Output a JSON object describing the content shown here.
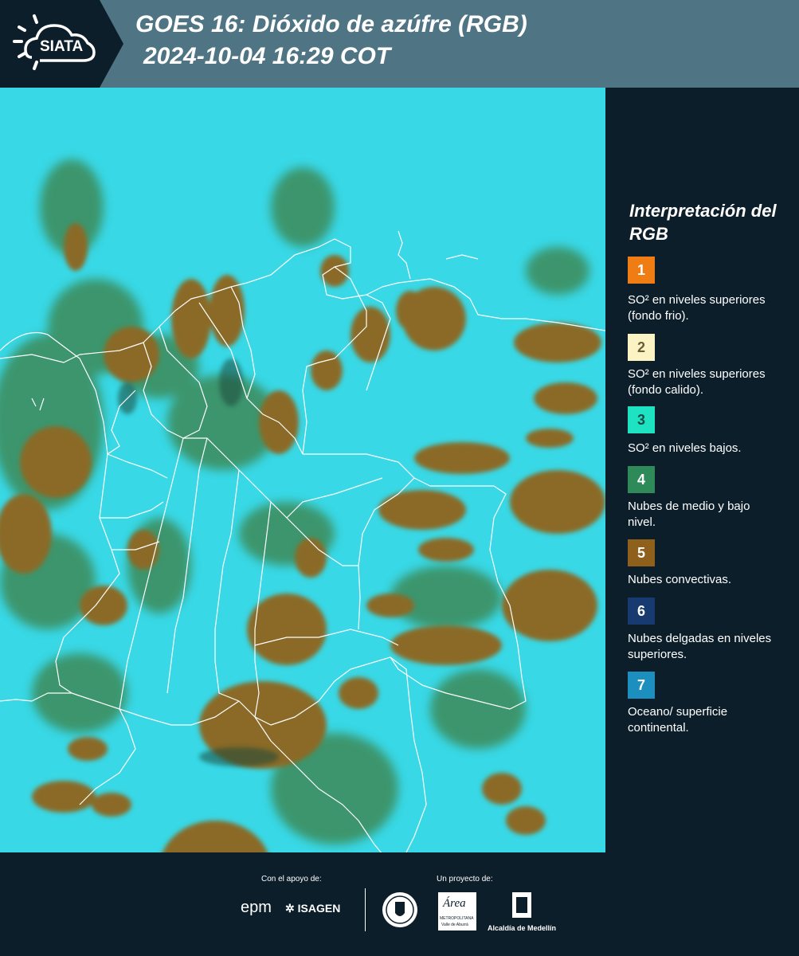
{
  "header": {
    "brand": "SIATA",
    "title_line1": "GOES 16: Dióxido de azúfre (RGB)",
    "title_line2": "2024-10-04 16:29 COT",
    "background_color": "#4f7584"
  },
  "legend": {
    "title": "Interpretación del RGB",
    "items": [
      {
        "number": "1",
        "label": "SO² en niveles superiores (fondo frio).",
        "color": "#f07d14",
        "number_color": "#ffffff"
      },
      {
        "number": "2",
        "label": "SO² en niveles superiores (fondo calido).",
        "color": "#fbf3c3",
        "number_color": "#6b5b3a"
      },
      {
        "number": "3",
        "label": "SO² en niveles bajos.",
        "color": "#1ee3c3",
        "number_color": "#1a4a46"
      },
      {
        "number": "4",
        "label": "Nubes de medio y bajo nivel.",
        "color": "#2f8a5a",
        "number_color": "#ffffff"
      },
      {
        "number": "5",
        "label": "Nubes convectivas.",
        "color": "#8f5f1c",
        "number_color": "#ffffff"
      },
      {
        "number": "6",
        "label": "Nubes delgadas en niveles superiores.",
        "color": "#173b70",
        "number_color": "#ffffff"
      },
      {
        "number": "7",
        "label": "Oceano/ superficie continental.",
        "color": "#1c8fbf",
        "number_color": "#ffffff"
      }
    ]
  },
  "map": {
    "background_color": "#38d8e6",
    "cloud_color": "#8a6a28",
    "low_cloud_color": "#3e8a58",
    "border_color": "#ffffff"
  },
  "footer": {
    "support_caption": "Con el apoyo de:",
    "project_caption": "Un proyecto de:",
    "sponsors": [
      "epm",
      "ISAGEN"
    ],
    "partners": [
      "Área Metropolitana Valle de Aburrá",
      "Alcaldía de Medellín"
    ],
    "area_logo_text": "Área",
    "area_sub_1": "METROPOLITANA",
    "area_sub_2": "Valle de Aburrá",
    "alcaldia_label": "Alcaldía de Medellín"
  }
}
